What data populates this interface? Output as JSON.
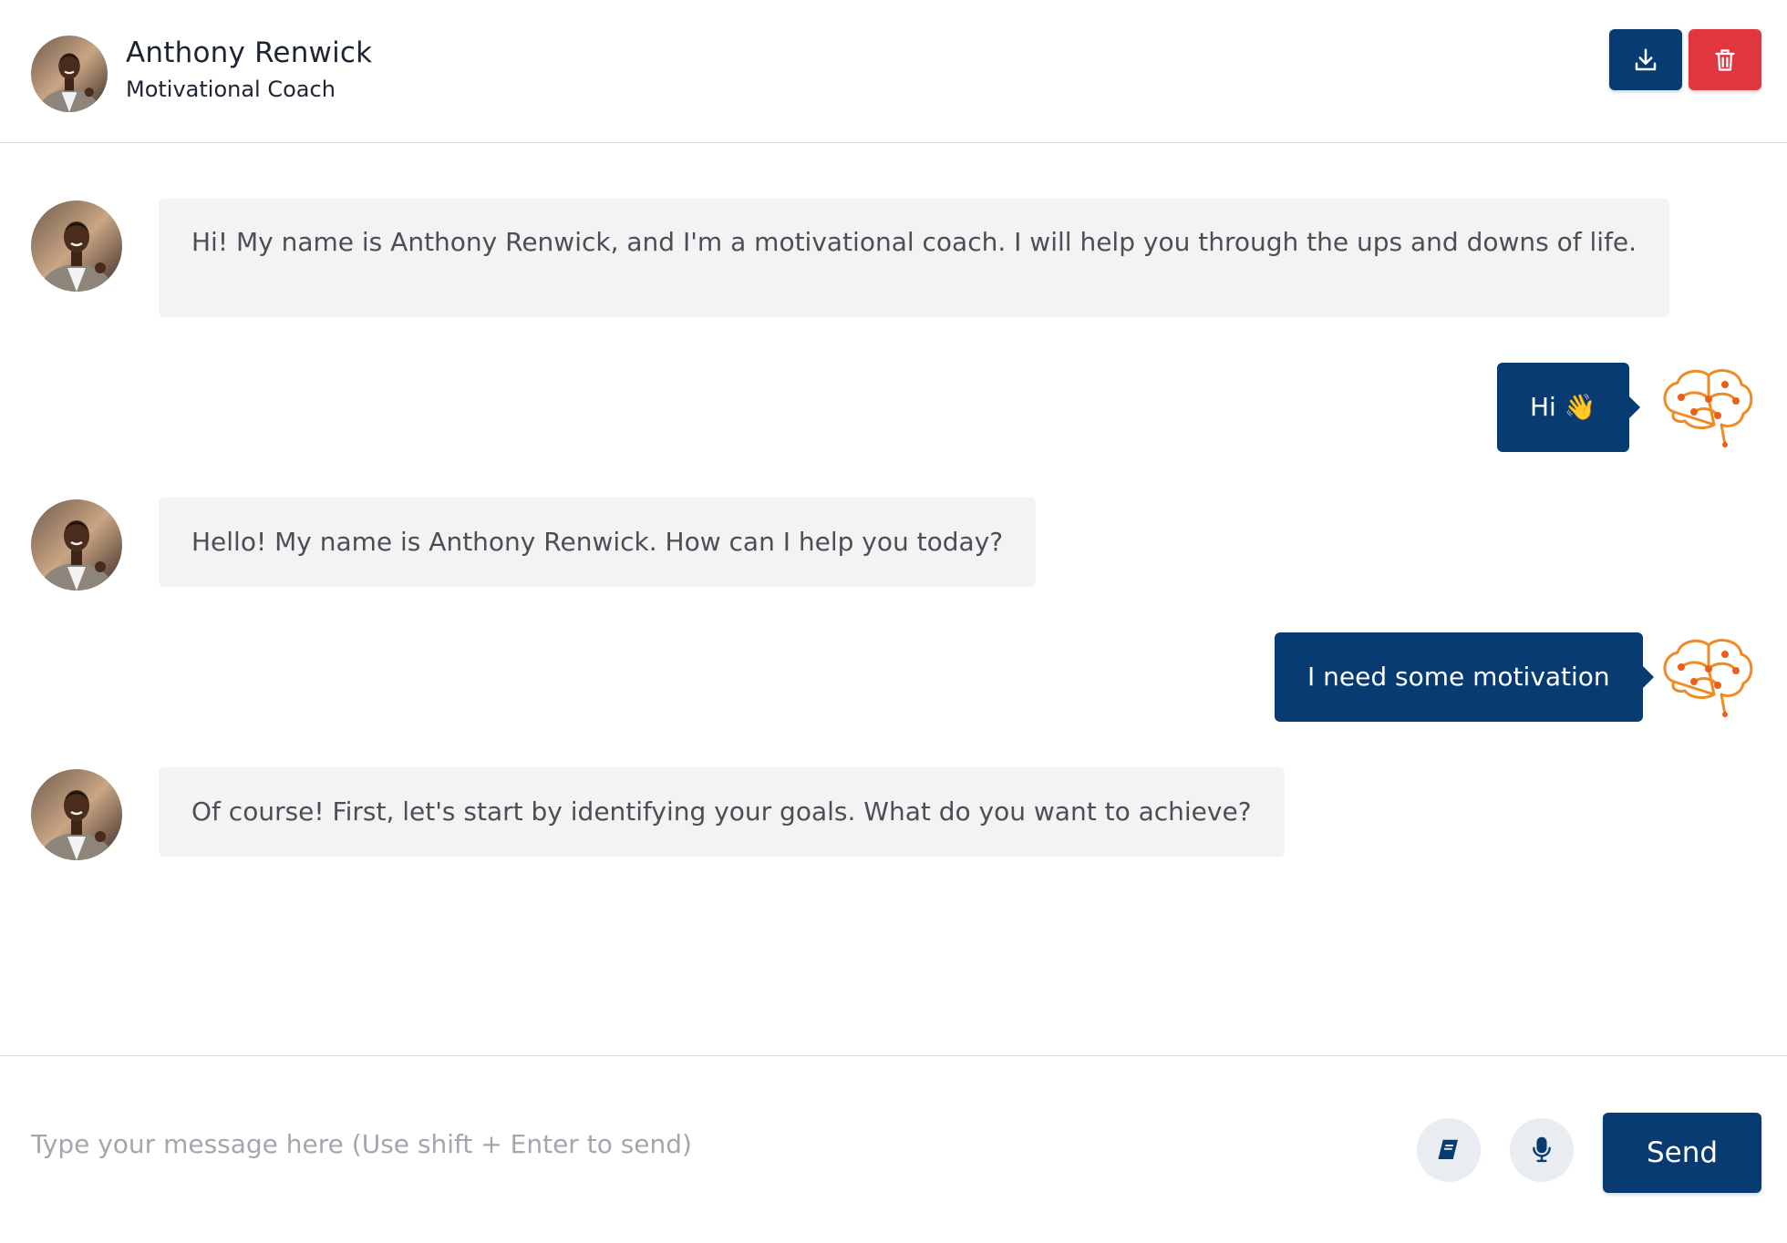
{
  "header": {
    "name": "Anthony Renwick",
    "role": "Motivational Coach",
    "download_icon": "download-icon",
    "delete_icon": "trash-icon"
  },
  "messages": [
    {
      "sender": "bot",
      "text": "Hi! My name is Anthony Renwick, and I'm a motivational coach. I will help you through the ups and downs of life."
    },
    {
      "sender": "user",
      "text": "Hi 👋"
    },
    {
      "sender": "bot",
      "text": "Hello! My name is Anthony Renwick. How can I help you today?"
    },
    {
      "sender": "user",
      "text": "I need some motivation"
    },
    {
      "sender": "bot",
      "text": "Of course! First, let's start by identifying your goals. What do you want to achieve?"
    }
  ],
  "composer": {
    "placeholder": "Type your message here (Use shift + Enter to send)",
    "value": "",
    "book_icon": "book-icon",
    "mic_icon": "microphone-icon",
    "send_label": "Send"
  },
  "colors": {
    "primary": "#073b72",
    "danger": "#e03640",
    "bot_bubble": "#f3f3f3",
    "brain_orange": "#f08a24"
  }
}
